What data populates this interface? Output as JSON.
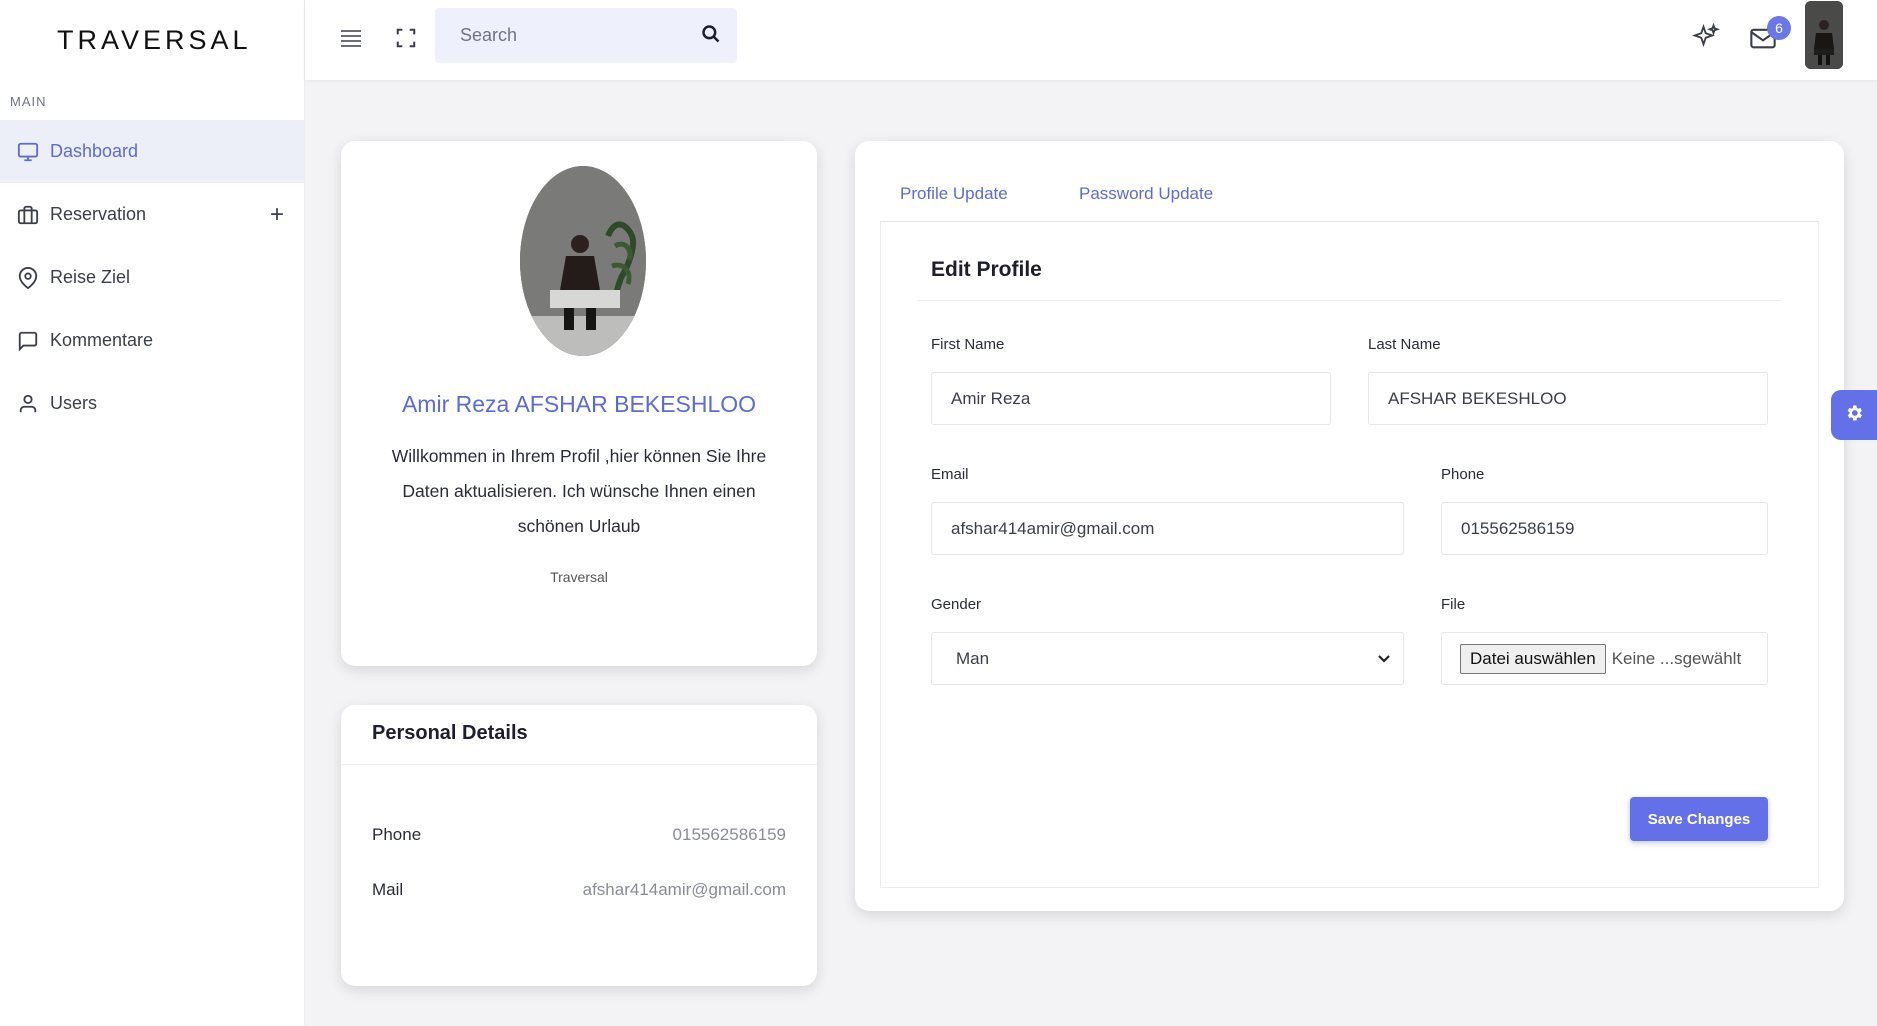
{
  "brand": "TRAVERSAL",
  "sidebar": {
    "section": "MAIN",
    "items": [
      {
        "label": "Dashboard",
        "icon": "monitor-icon"
      },
      {
        "label": "Reservation",
        "icon": "briefcase-icon",
        "expand": "+"
      },
      {
        "label": "Reise Ziel",
        "icon": "map-pin-icon"
      },
      {
        "label": "Kommentare",
        "icon": "chat-icon"
      },
      {
        "label": "Users",
        "icon": "user-icon"
      }
    ]
  },
  "header": {
    "search_placeholder": "Search",
    "notification_count": "6"
  },
  "profile": {
    "name": "Amir Reza AFSHAR BEKESHLOO",
    "description": "Willkommen in Ihrem Profil ,hier können Sie Ihre Daten aktualisieren. Ich wünsche Ihnen einen schönen Urlaub",
    "subtitle": "Traversal"
  },
  "personal_details": {
    "title": "Personal Details",
    "phone_label": "Phone",
    "phone_value": "015562586159",
    "mail_label": "Mail",
    "mail_value": "afshar414amir@gmail.com"
  },
  "edit": {
    "tabs": [
      "Profile Update",
      "Password Update"
    ],
    "title": "Edit Profile",
    "first_name_label": "First Name",
    "first_name": "Amir Reza",
    "last_name_label": "Last Name",
    "last_name": "AFSHAR BEKESHLOO",
    "email_label": "Email",
    "email": "afshar414amir@gmail.com",
    "phone_label": "Phone",
    "phone": "015562586159",
    "gender_label": "Gender",
    "gender": "Man",
    "file_label": "File",
    "file_button": "Datei auswählen",
    "file_status": "Keine ...sgewählt",
    "save_label": "Save Changes"
  },
  "colors": {
    "accent": "#5b6cd6",
    "button": "#6470e8",
    "active_bg": "#eceef8"
  }
}
